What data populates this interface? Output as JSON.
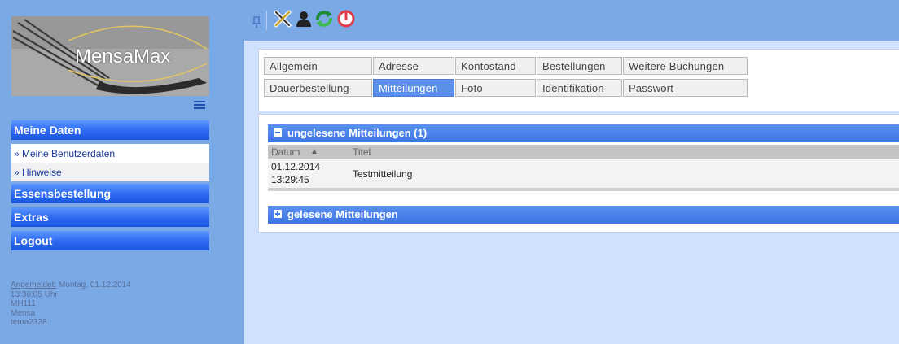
{
  "app": {
    "logo_text": "MensaMax"
  },
  "toolbar": {
    "icons": [
      "pin-icon",
      "tools-icon",
      "user-icon",
      "refresh-icon",
      "power-icon"
    ]
  },
  "sidebar": {
    "sections": [
      {
        "label": "Meine Daten",
        "expanded": true,
        "items": [
          {
            "label": "» Meine Benutzerdaten"
          },
          {
            "label": "» Hinweise"
          }
        ]
      },
      {
        "label": "Essensbestellung"
      },
      {
        "label": "Extras"
      },
      {
        "label": "Logout"
      }
    ],
    "session": {
      "login_label": "Angemeldet:",
      "login_date": "Montag, 01.12.2014",
      "login_time": "13:30:05 Uhr",
      "user_id": "MH111",
      "facility": "Mensa",
      "account": "tema2328"
    }
  },
  "tabs": {
    "row1": [
      "Allgemein",
      "Adresse",
      "Kontostand",
      "Bestellungen",
      "Weitere Buchungen"
    ],
    "row2": [
      "Dauerbestellung",
      "Mitteilungen",
      "Foto",
      "Identifikation",
      "Passwort"
    ],
    "active": "Mitteilungen"
  },
  "messages": {
    "unread_header": "ungelesene Mitteilungen (1)",
    "read_header": "gelesene Mitteilungen",
    "columns": {
      "date": "Datum",
      "sort_arrow": "▲",
      "title": "Titel"
    },
    "rows": [
      {
        "date": "01.12.2014",
        "time": "13:29:45",
        "title": "Testmitteilung"
      }
    ]
  },
  "colors": {
    "background": "#7aa9e6",
    "nav_blue": "#2f6cf2",
    "active_tab": "#5c8fea",
    "content_bg": "#d0e1ff"
  }
}
